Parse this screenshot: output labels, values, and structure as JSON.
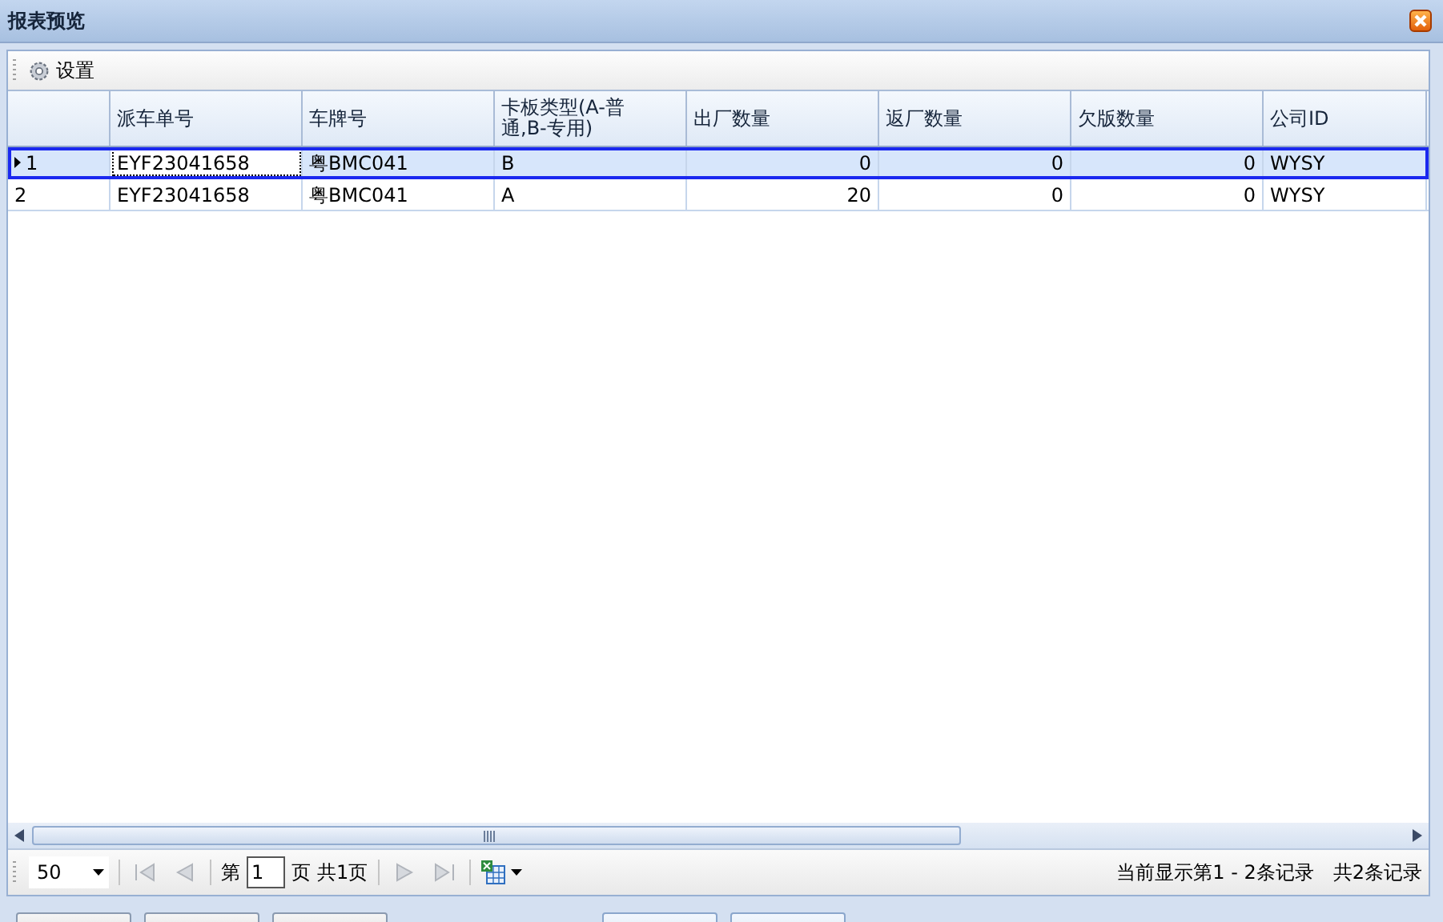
{
  "window": {
    "title": "报表预览"
  },
  "toolbar": {
    "settings_label": "设置"
  },
  "table": {
    "columns": [
      {
        "label": "派车单号",
        "kind": "text"
      },
      {
        "label": "车牌号",
        "kind": "text"
      },
      {
        "label": "卡板类型(A-普通,B-专用)",
        "kind": "text"
      },
      {
        "label": "出厂数量",
        "kind": "number"
      },
      {
        "label": "返厂数量",
        "kind": "number"
      },
      {
        "label": "欠版数量",
        "kind": "number"
      },
      {
        "label": "公司ID",
        "kind": "text"
      }
    ],
    "rows": [
      {
        "selected": true,
        "number": "1",
        "cells": [
          "EYF23041658",
          "粤BMC041",
          "B",
          "0",
          "0",
          "0",
          "WYSY"
        ]
      },
      {
        "selected": false,
        "number": "2",
        "cells": [
          "EYF23041658",
          "粤BMC041",
          "A",
          "20",
          "0",
          "0",
          "WYSY"
        ]
      }
    ]
  },
  "pager": {
    "page_size": "50",
    "page_prefix": "第",
    "page": "1",
    "page_suffix": "页",
    "total_pages": "共1页",
    "shown": "当前显示第1 - 2条记录",
    "total": "共2条记录"
  }
}
